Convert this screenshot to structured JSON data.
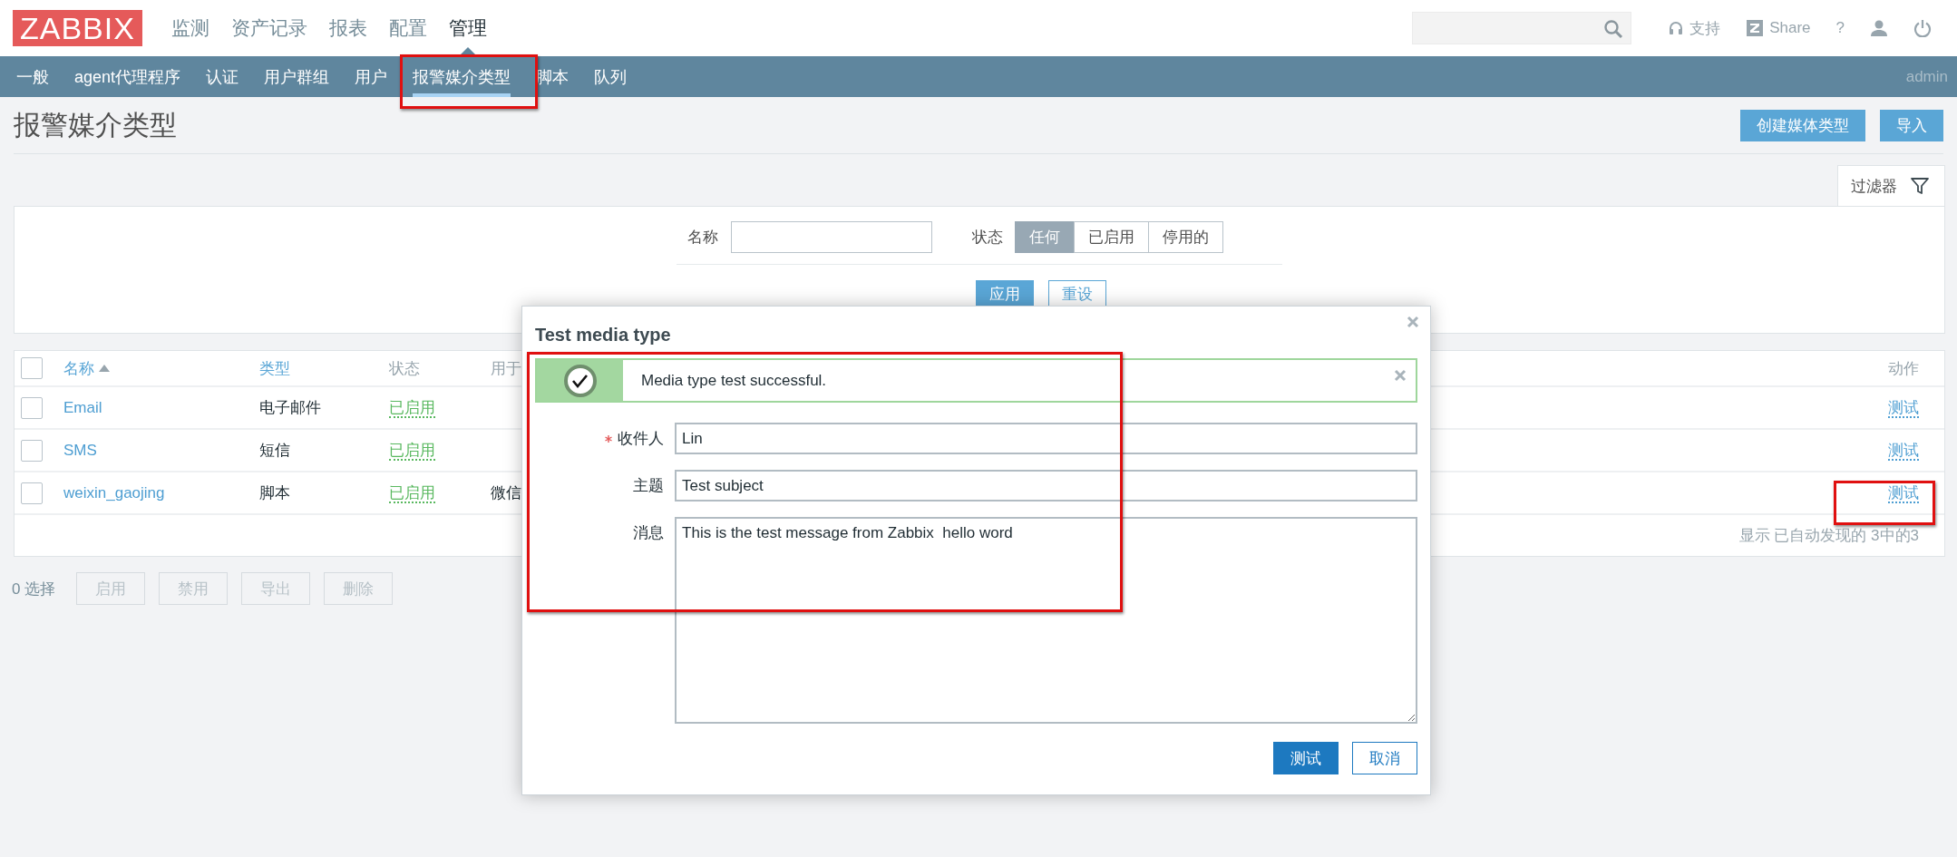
{
  "header": {
    "logo": "ZABBIX",
    "menu": [
      {
        "label": "监测",
        "selected": false
      },
      {
        "label": "资产记录",
        "selected": false
      },
      {
        "label": "报表",
        "selected": false
      },
      {
        "label": "配置",
        "selected": false
      },
      {
        "label": "管理",
        "selected": true
      }
    ],
    "tools": [
      {
        "kind": "support",
        "label": "支持"
      },
      {
        "kind": "share",
        "label": "Share"
      },
      {
        "kind": "help",
        "label": "?"
      },
      {
        "kind": "user"
      },
      {
        "kind": "logout"
      }
    ]
  },
  "submenu": {
    "items": [
      {
        "label": "一般",
        "selected": false
      },
      {
        "label": "agent代理程序",
        "selected": false
      },
      {
        "label": "认证",
        "selected": false
      },
      {
        "label": "用户群组",
        "selected": false
      },
      {
        "label": "用户",
        "selected": false
      },
      {
        "label": "报警媒介类型",
        "selected": true
      },
      {
        "label": "脚本",
        "selected": false
      },
      {
        "label": "队列",
        "selected": false
      }
    ],
    "user": "admin"
  },
  "page": {
    "title": "报警媒介类型",
    "buttons": [
      "创建媒体类型",
      "导入"
    ]
  },
  "filter": {
    "tab": "过滤器",
    "name_label": "名称",
    "status_label": "状态",
    "status_options": [
      {
        "label": "任何",
        "selected": true
      },
      {
        "label": "已启用",
        "selected": false
      },
      {
        "label": "停用的",
        "selected": false
      }
    ],
    "buttons": [
      {
        "label": "应用",
        "kind": "primary"
      },
      {
        "label": "重设",
        "kind": "secondary"
      }
    ]
  },
  "table": {
    "all_checked": false,
    "columns": [
      {
        "label": "名称",
        "kind": "sortable",
        "sorted_ascending": true
      },
      {
        "label": "类型",
        "kind": "sortable"
      },
      {
        "label": "状态",
        "kind": "plain"
      },
      {
        "label": "用于",
        "kind": "plain"
      },
      {
        "label": "动作",
        "kind": "action"
      }
    ],
    "rows": [
      {
        "checked": false,
        "name": "Email",
        "type": "电子邮件",
        "status": "已启用",
        "enabled": true,
        "action": "测试"
      },
      {
        "checked": false,
        "name": "SMS",
        "type": "短信",
        "status": "已启用",
        "enabled": true,
        "action": "测试"
      },
      {
        "checked": false,
        "name": "weixin_gaojing",
        "type": "脚本",
        "status": "已启用",
        "enabled": true,
        "used_in": "微信",
        "action": "测试"
      }
    ],
    "footer": "显示 已自动发现的 3中的3"
  },
  "bulk": {
    "count": "0 选择",
    "buttons": [
      {
        "label": "启用",
        "disabled": true
      },
      {
        "label": "禁用",
        "disabled": true
      },
      {
        "label": "导出",
        "disabled": true
      },
      {
        "label": "删除",
        "disabled": true
      }
    ]
  },
  "dialog": {
    "title": "Test media type",
    "message": {
      "kind": "success",
      "text": "Media type test successful."
    },
    "fields": [
      {
        "label": "收件人",
        "required": true,
        "kind": "input",
        "value": "Lin"
      },
      {
        "label": "主题",
        "required": false,
        "kind": "input",
        "value": "Test subject"
      },
      {
        "label": "消息",
        "required": false,
        "kind": "textarea",
        "value": "This is the test message from Zabbix  hello word"
      }
    ],
    "buttons": [
      {
        "label": "测试",
        "kind": "primary"
      },
      {
        "label": "取消",
        "kind": "secondary"
      }
    ]
  }
}
